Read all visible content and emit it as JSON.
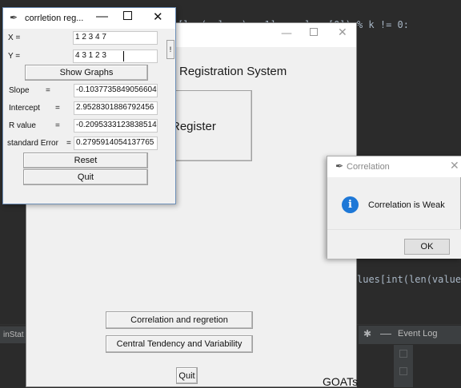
{
  "ide": {
    "code_top": "[len(values) - 1] - values[0]) % k != 0:",
    "code_mid": "lues[int(len(values",
    "run_tab": "inStat",
    "event_log_title": "Event Log",
    "gear_icon": "gear-icon",
    "minimize_icon": "minimize-icon"
  },
  "main_window": {
    "title": "",
    "heading": "Registration System",
    "register_button": "Register",
    "correlation_button": "Correlation and regretion",
    "central_tendency_button": "Central Tendency and Variability",
    "quit_button": "Quit",
    "footer_label": "GOATs"
  },
  "popup": {
    "title": "Correlation",
    "message": "Correlation is Weak",
    "ok_button": "OK",
    "info_icon": "i",
    "accent": "#1e78d7"
  },
  "regression_window": {
    "title": "corrletion reg...",
    "x_label": "X =",
    "x_value": "1 2 3 4 7",
    "y_label": "Y =",
    "y_value": "4 3 1 2 3",
    "show_graphs_button": "Show Graphs",
    "slope_label": "Slope",
    "slope_eq": "=",
    "slope_value": "-0.10377358490566041",
    "intercept_label": "Intercept",
    "intercept_eq": "=",
    "intercept_value": "2.9528301886792456",
    "r_label": "R value",
    "r_eq": "=",
    "r_value": "-0.2095333123838514",
    "se_label": "standard Error",
    "se_eq": "=",
    "se_value": "0.2795914054137765",
    "reset_button": "Reset",
    "quit_button": "Quit",
    "scroll_glyph": "!"
  }
}
